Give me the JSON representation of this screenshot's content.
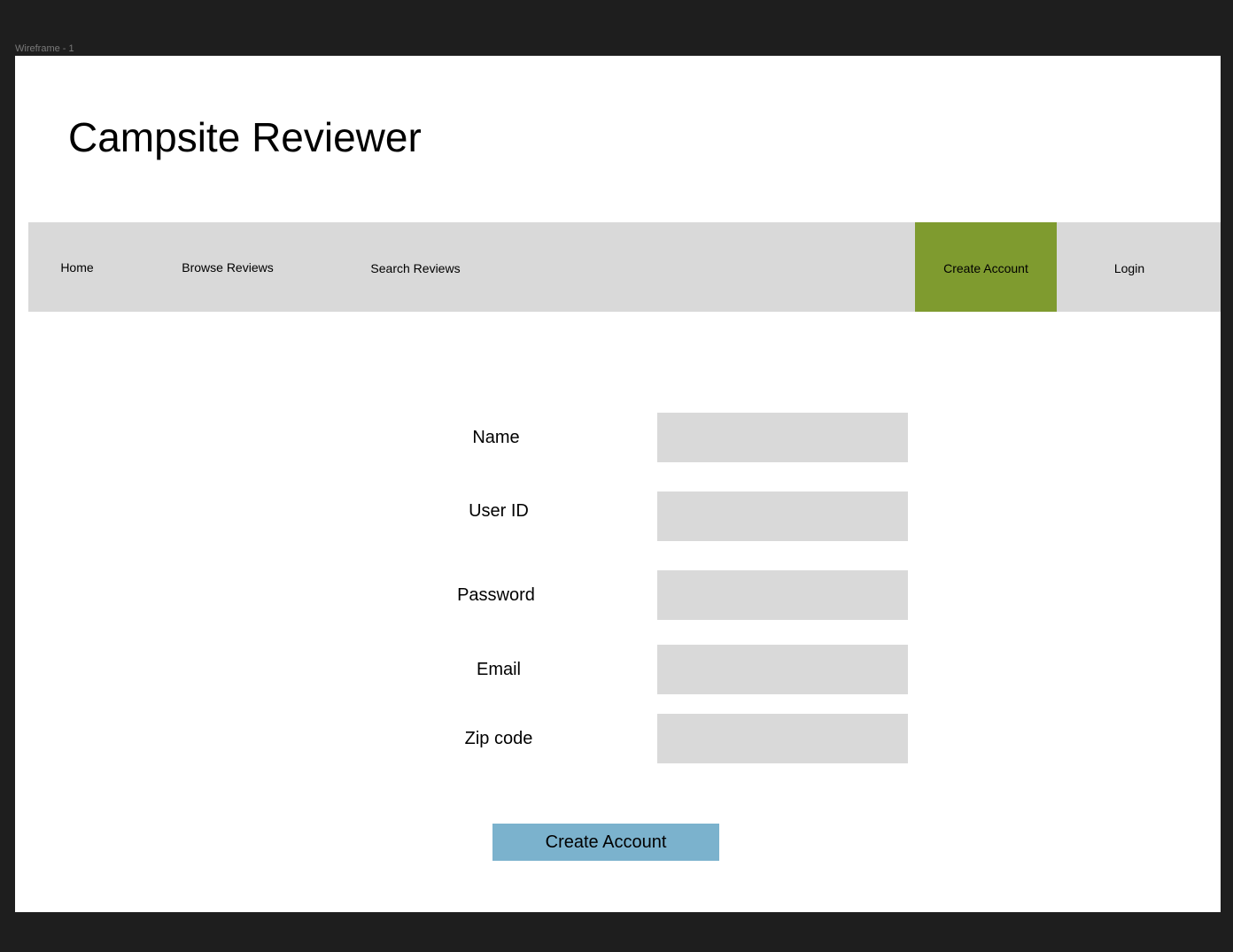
{
  "frame": {
    "label": "Wireframe - 1"
  },
  "header": {
    "title": "Campsite Reviewer"
  },
  "nav": {
    "items": [
      {
        "label": "Home"
      },
      {
        "label": "Browse Reviews"
      },
      {
        "label": "Search Reviews"
      },
      {
        "label": "Create Account",
        "active": true
      },
      {
        "label": "Login"
      }
    ],
    "background_color": "#d9d9d9",
    "active_color": "#7f9b2f"
  },
  "form": {
    "fields": [
      {
        "label": "Name",
        "value": ""
      },
      {
        "label": "User ID",
        "value": ""
      },
      {
        "label": "Password",
        "value": ""
      },
      {
        "label": "Email",
        "value": ""
      },
      {
        "label": "Zip code",
        "value": ""
      }
    ],
    "submit_label": "Create Account",
    "submit_color": "#7bb2cd"
  }
}
